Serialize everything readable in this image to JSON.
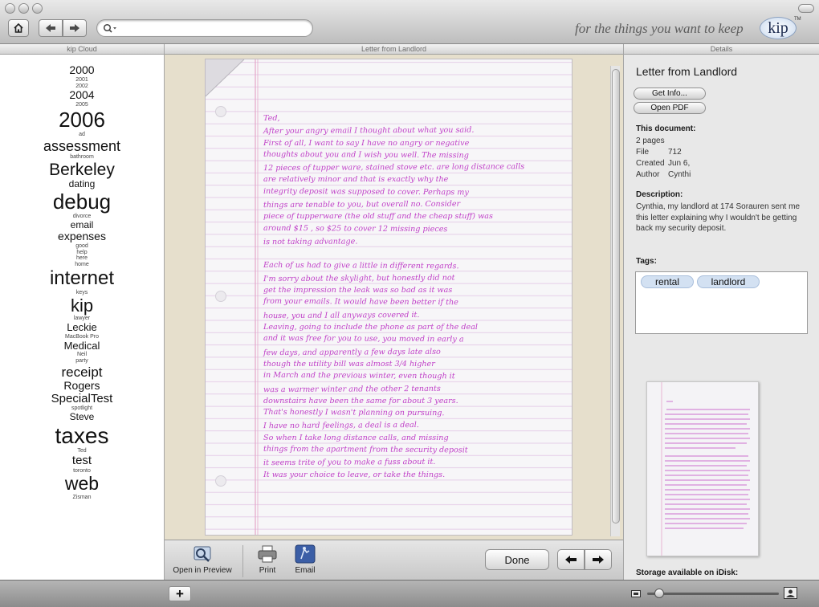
{
  "app": {
    "tagline": "for the things you want to keep",
    "logo": "kip",
    "trademark": "TM"
  },
  "toolbar": {
    "search_placeholder": ""
  },
  "panels": {
    "left_header": "kip Cloud",
    "center_header": "Letter from Landlord",
    "right_header": "Details"
  },
  "cloud": [
    {
      "label": "2000",
      "size": 14
    },
    {
      "label": "2001",
      "size": 7
    },
    {
      "label": "2002",
      "size": 7
    },
    {
      "label": "2004",
      "size": 14
    },
    {
      "label": "2005",
      "size": 7
    },
    {
      "label": "2006",
      "size": 26
    },
    {
      "label": "ad",
      "size": 7
    },
    {
      "label": "assessment",
      "size": 18
    },
    {
      "label": "bathroom",
      "size": 7
    },
    {
      "label": "Berkeley",
      "size": 21
    },
    {
      "label": "dating",
      "size": 12
    },
    {
      "label": "debug",
      "size": 26
    },
    {
      "label": "divorce",
      "size": 7
    },
    {
      "label": "email",
      "size": 12
    },
    {
      "label": "expenses",
      "size": 14
    },
    {
      "label": "good",
      "size": 7
    },
    {
      "label": "help",
      "size": 7
    },
    {
      "label": "here",
      "size": 7
    },
    {
      "label": "home",
      "size": 7
    },
    {
      "label": "internet",
      "size": 24
    },
    {
      "label": "keys",
      "size": 7
    },
    {
      "label": "kip",
      "size": 22
    },
    {
      "label": "lawyer",
      "size": 7
    },
    {
      "label": "Leckie",
      "size": 13
    },
    {
      "label": "MacBook Pro",
      "size": 7
    },
    {
      "label": "Medical",
      "size": 13
    },
    {
      "label": "Neil",
      "size": 7
    },
    {
      "label": "party",
      "size": 7
    },
    {
      "label": "receipt",
      "size": 17
    },
    {
      "label": "Rogers",
      "size": 14
    },
    {
      "label": "SpecialTest",
      "size": 15
    },
    {
      "label": "spotlight",
      "size": 7
    },
    {
      "label": "Steve",
      "size": 12
    },
    {
      "label": "taxes",
      "size": 28
    },
    {
      "label": "Ted",
      "size": 7
    },
    {
      "label": "test",
      "size": 15
    },
    {
      "label": "toronto",
      "size": 7
    },
    {
      "label": "web",
      "size": 23
    },
    {
      "label": "Zisman",
      "size": 7
    }
  ],
  "viewer": {
    "open_in_preview": "Open in Preview",
    "print": "Print",
    "email": "Email",
    "done": "Done",
    "letter": {
      "salutation": "Ted,",
      "lines": [
        "After your angry email I thought about what you said.",
        "First of all, I want to say I have no angry or negative",
        "thoughts about you and I wish you well. The missing",
        "12 pieces of tupper ware, stained stove etc. are long distance calls",
        "are relatively minor and that is exactly why the",
        "integrity deposit was supposed to cover. Perhaps my",
        "things are tenable to you, but overall no. Consider",
        "piece of tupperware (the old stuff and the cheap stuff) was",
        "around $15 , so $25 to cover 12 missing pieces",
        "is not taking advantage.",
        "",
        "Each of us had to give a little in different regards.",
        "I'm sorry about the skylight, but honestly did not",
        "get the impression the leak was so bad as it was",
        "from your emails. It would have been better if the",
        "house, you and I all anyways covered it.",
        "Leaving, going to include the phone as part of the deal",
        "and it was free for you to use, you moved in early a",
        "few days, and apparently a few days late also",
        "though the utility bill was almost 3/4 higher",
        "in March and the previous winter, even though it",
        "was a warmer winter and the other 2 tenants",
        "downstairs have been the same for about 3 years.",
        "That's honestly I wasn't planning on pursuing.",
        "I have no hard feelings, a deal is a deal.",
        "So when I take long distance calls, and missing",
        "things from the apartment from the security deposit",
        "it seems trite of you to make a fuss about it.",
        "It was your choice to leave, or take the things."
      ]
    }
  },
  "details": {
    "title": "Letter from Landlord",
    "get_info": "Get Info...",
    "open_pdf": "Open PDF",
    "this_document_label": "This document:",
    "pages": "2 pages",
    "file_label": "File",
    "file_value": "712",
    "created_label": "Created",
    "created_value": "Jun 6,",
    "author_label": "Author",
    "author_value": "Cynthi",
    "description_label": "Description:",
    "description": "Cynthia, my landlord at 174 Sorauren sent me this letter explaining why I wouldn't be getting back my security deposit.",
    "tags_label": "Tags:",
    "tags": [
      "rental",
      "landlord"
    ],
    "storage_label": "Storage available on iDisk:"
  },
  "footer": {
    "add_label": "+"
  },
  "colors": {
    "ink": "#c040c8",
    "rule": "#e3c8e6",
    "tag_bg": "#d3e1f2"
  }
}
